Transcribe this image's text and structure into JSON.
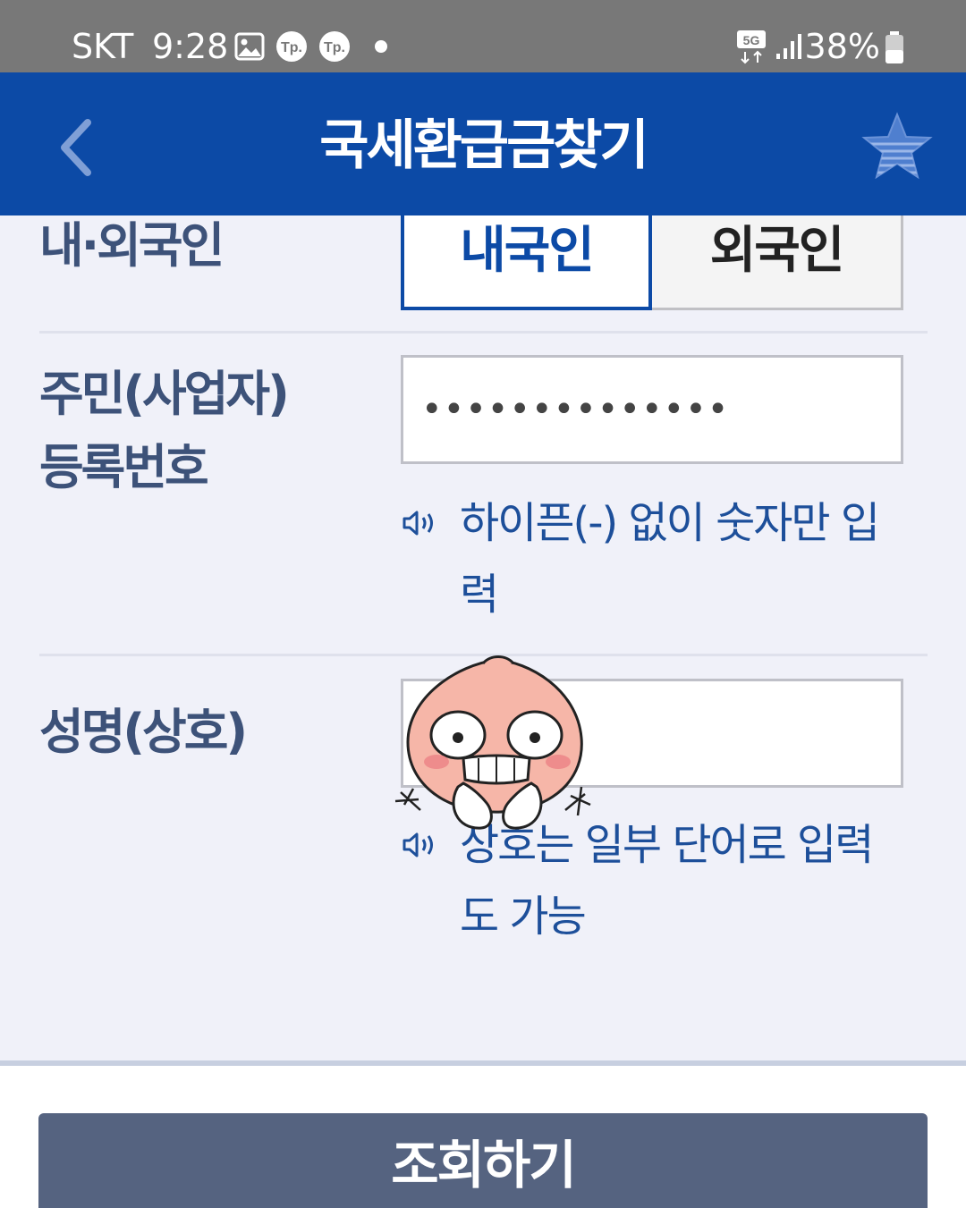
{
  "status_bar": {
    "carrier": "SKT",
    "time": "9:28",
    "battery": "38%",
    "notification_icons": [
      "gallery-icon",
      "tp-icon",
      "tp-icon",
      "dot-icon"
    ],
    "system_icons": [
      "5g-icon",
      "signal-icon",
      "battery-icon"
    ]
  },
  "header": {
    "title": "국세환급금찾기",
    "back_icon": "chevron-left-icon",
    "favorite_icon": "star-icon"
  },
  "form": {
    "nationality": {
      "label": "내·외국인",
      "options": [
        "내국인",
        "외국인"
      ],
      "selected": "내국인"
    },
    "registration_number": {
      "label_line1": "주민(사업자)",
      "label_line2": "등록번호",
      "value": "••••••••••••••",
      "help_line1": "하이픈(-) 없이 숫자만 입",
      "help_line2": "력"
    },
    "name": {
      "label": "성명(상호)",
      "value": "",
      "help_line1": "상호는 일부 단어로 입력",
      "help_line2": "도 가능"
    }
  },
  "submit_label": "조회하기",
  "colors": {
    "primary": "#0c4aa6",
    "label": "#3d5279",
    "button": "#556380",
    "background": "#f0f1f9"
  }
}
